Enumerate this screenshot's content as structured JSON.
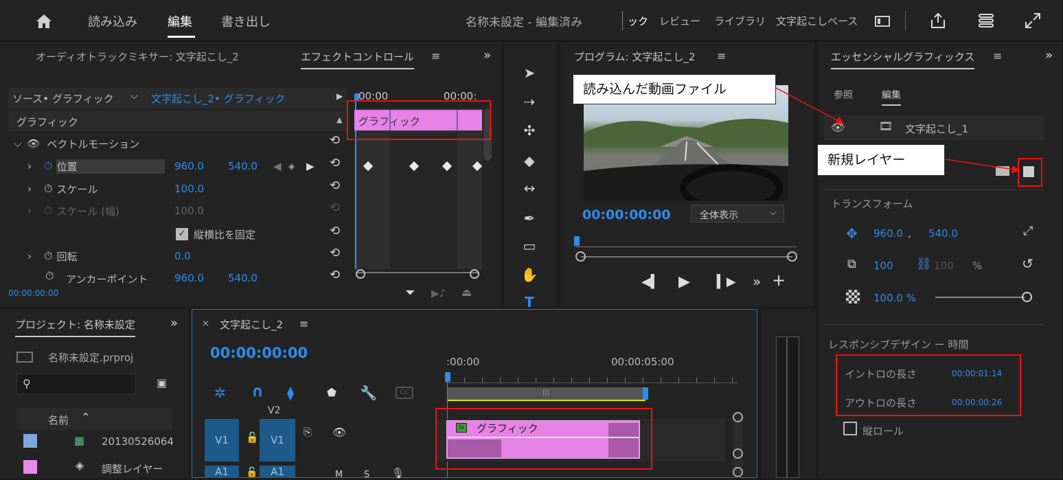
{
  "topbar": {
    "home_icon": "home-icon",
    "tabs": [
      {
        "label": "読み込み"
      },
      {
        "label": "編集"
      },
      {
        "label": "書き出し"
      }
    ],
    "project_title": "名称未設定 - 編集済み",
    "workspaces": [
      "ック",
      "レビュー",
      "ライブラリ",
      "文字起こしベース"
    ],
    "icons": [
      "panel-icon",
      "share-icon",
      "settings-icon",
      "expand-icon"
    ]
  },
  "effect_controls": {
    "tab_mixer": "オーディオトラックミキサー: 文字起こし_2",
    "tab_effect": "エフェクトコントロール",
    "source_label": "ソース• グラフィック",
    "target_label": "文字起こし_2• グラフィック",
    "section": "グラフィック",
    "group": "ベクトルモーション",
    "time_left": "00:00",
    "time_right": "00:00:",
    "clip_label": "グラフィック",
    "params": [
      {
        "name": "位置",
        "v1": "960.0",
        "v2": "540.0"
      },
      {
        "name": "スケール",
        "v1": "100.0"
      },
      {
        "name": "スケール (幅)",
        "v1": "100.0"
      },
      {
        "name": "縦横比を固定"
      },
      {
        "name": "回転",
        "v1": "0.0"
      },
      {
        "name": "アンカーポイント",
        "v1": "960.0",
        "v2": "540.0"
      }
    ],
    "timecode": "00:00:00:00"
  },
  "program": {
    "title": "プログラム: 文字起こし_2",
    "timecode": "00:00:00:00",
    "zoom": "全体表示"
  },
  "essential_graphics": {
    "title": "エッセンシャルグラフィックス",
    "tab_browse": "参照",
    "tab_edit": "編集",
    "layer_name": "文字起こし_1",
    "transform_label": "トランスフォーム",
    "pos_x": "960.0",
    "pos_y": "540.0",
    "scale": "100",
    "scale_w": "100",
    "percent": "%",
    "opacity": "100.0 %",
    "responsive_label": "レスポンシブデザイン ー 時間",
    "intro_label": "イントロの長さ",
    "intro_value": "00:00:01:14",
    "outro_label": "アウトロの長さ",
    "outro_value": "00:00:00:26",
    "roll_label": "縦ロール"
  },
  "project": {
    "title": "プロジェクト: 名称未設定",
    "file": "名称未設定.prproj",
    "col_name": "名前",
    "items": [
      {
        "name": "20130526064",
        "color": "#7da7d9"
      },
      {
        "name": "調整レイヤー",
        "color": "#e88ae8"
      }
    ]
  },
  "timeline": {
    "title": "文字起こし_2",
    "timecode": "00:00:00:00",
    "ruler_start": ":00:00",
    "ruler_mid": "00:00:05:00",
    "tracks": {
      "v2": "V2",
      "v1a": "V1",
      "v1b": "V1",
      "a1a": "A1",
      "a1b": "A1"
    },
    "clip_label": "グラフィック"
  },
  "callouts": {
    "video_file": "読み込んだ動画ファイル",
    "new_layer": "新規レイヤー"
  }
}
